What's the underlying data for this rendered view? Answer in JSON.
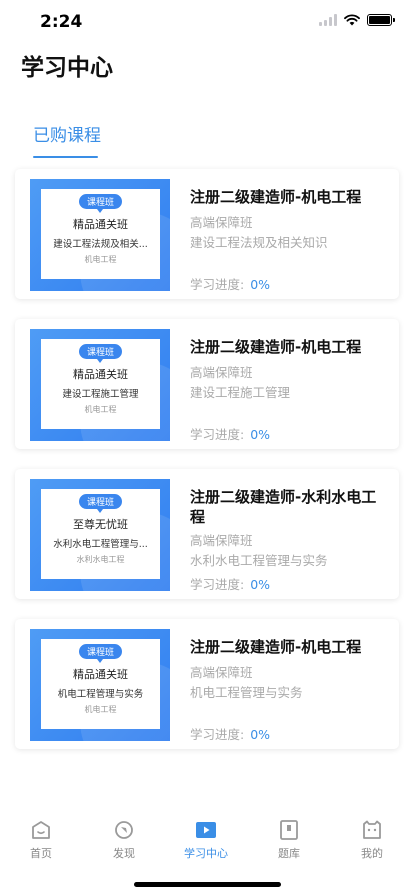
{
  "status_bar": {
    "time": "2:24"
  },
  "page": {
    "title": "学习中心"
  },
  "tabs": {
    "bought_label": "已购课程"
  },
  "courses": [
    {
      "cover_badge": "课程班",
      "cover_title": "精品通关班",
      "cover_subtitle": "建设工程法规及相关...",
      "cover_tag": "机电工程",
      "name": "注册二级建造师-机电工程",
      "level": "高端保障班",
      "subject": "建设工程法规及相关知识",
      "progress_label": "学习进度:",
      "progress_value": "0%"
    },
    {
      "cover_badge": "课程班",
      "cover_title": "精品通关班",
      "cover_subtitle": "建设工程施工管理",
      "cover_tag": "机电工程",
      "name": "注册二级建造师-机电工程",
      "level": "高端保障班",
      "subject": "建设工程施工管理",
      "progress_label": "学习进度:",
      "progress_value": "0%"
    },
    {
      "cover_badge": "课程班",
      "cover_title": "至尊无忧班",
      "cover_subtitle": "水利水电工程管理与...",
      "cover_tag": "水利水电工程",
      "name": "注册二级建造师-水利水电工程",
      "level": "高端保障班",
      "subject": "水利水电工程管理与实务",
      "progress_label": "学习进度:",
      "progress_value": "0%"
    },
    {
      "cover_badge": "课程班",
      "cover_title": "精品通关班",
      "cover_subtitle": "机电工程管理与实务",
      "cover_tag": "机电工程",
      "name": "注册二级建造师-机电工程",
      "level": "高端保障班",
      "subject": "机电工程管理与实务",
      "progress_label": "学习进度:",
      "progress_value": "0%"
    }
  ],
  "tabbar": [
    {
      "label": "首页",
      "icon": "home-icon",
      "active": false
    },
    {
      "label": "发现",
      "icon": "discover-icon",
      "active": false
    },
    {
      "label": "学习中心",
      "icon": "play-icon",
      "active": true
    },
    {
      "label": "题库",
      "icon": "question-bank-icon",
      "active": false
    },
    {
      "label": "我的",
      "icon": "profile-icon",
      "active": false
    }
  ],
  "colors": {
    "accent": "#3a8ee6",
    "cover_blue": "#2f7df0",
    "muted_text": "#aaaaaa"
  }
}
